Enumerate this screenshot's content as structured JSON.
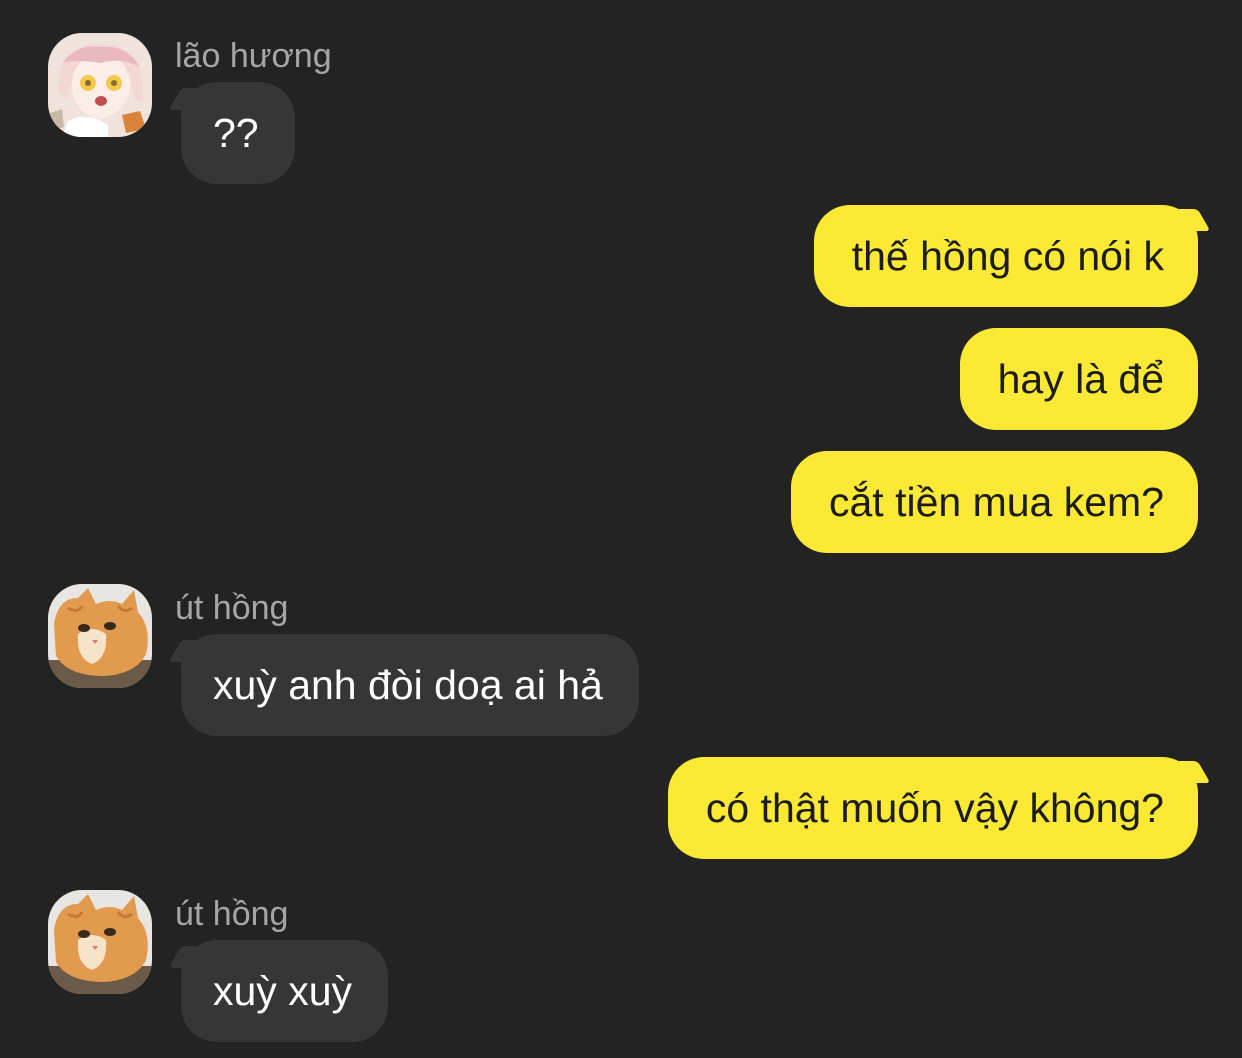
{
  "messages": [
    {
      "sender": "lão hương",
      "avatar": "anime-girl-avatar",
      "text": "??"
    },
    {
      "text": "thế hồng có nói k"
    },
    {
      "text": "hay là để"
    },
    {
      "text": "cắt tiền mua kem?"
    },
    {
      "sender": "út hồng",
      "avatar": "orange-cat-avatar",
      "text": "xuỳ anh đòi doạ ai hả"
    },
    {
      "text": "có thật muốn vậy không?"
    },
    {
      "sender": "út hồng",
      "avatar": "orange-cat-avatar",
      "text": "xuỳ xuỳ"
    }
  ],
  "colors": {
    "background": "#232323",
    "incoming_bubble": "#363636",
    "outgoing_bubble": "#fce935",
    "sender_name": "#a6a6a6"
  }
}
